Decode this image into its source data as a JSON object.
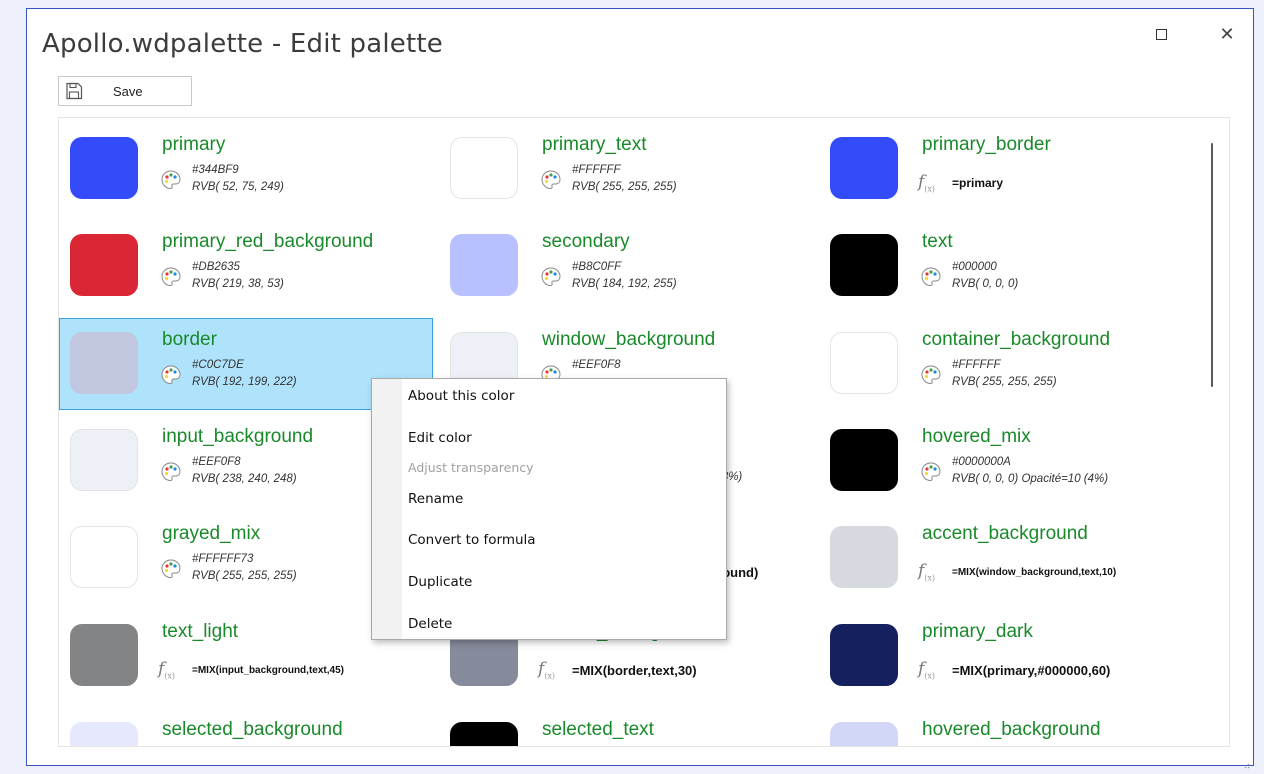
{
  "window": {
    "title": "Apollo.wdpalette - Edit palette"
  },
  "toolbar": {
    "save_label": "Save"
  },
  "items": [
    {
      "name": "primary",
      "color": "#344BF9",
      "kind": "color",
      "hex": "#344BF9",
      "rgb": "RVB( 52, 75, 249)"
    },
    {
      "name": "primary_text",
      "color": "#FFFFFF",
      "kind": "color",
      "hex": "#FFFFFF",
      "rgb": "RVB( 255, 255, 255)"
    },
    {
      "name": "primary_border",
      "color": "#344BF9",
      "kind": "formula",
      "formula": "=primary"
    },
    {
      "name": "primary_red_background",
      "color": "#DB2635",
      "kind": "color",
      "hex": "#DB2635",
      "rgb": "RVB( 219, 38, 53)"
    },
    {
      "name": "secondary",
      "color": "#B8C0FF",
      "kind": "color",
      "hex": "#B8C0FF",
      "rgb": "RVB( 184, 192, 255)"
    },
    {
      "name": "text",
      "color": "#000000",
      "kind": "color",
      "hex": "#000000",
      "rgb": "RVB( 0, 0, 0)"
    },
    {
      "name": "border",
      "color": "#C0C7DE",
      "kind": "color",
      "hex": "#C0C7DE",
      "rgb": "RVB( 192, 199, 222)"
    },
    {
      "name": "window_background",
      "color": "#EEF0F8",
      "kind": "color",
      "hex": "#EEF0F8",
      "rgb": ""
    },
    {
      "name": "container_background",
      "color": "#FFFFFF",
      "kind": "color",
      "hex": "#FFFFFF",
      "rgb": "RVB( 255, 255, 255)"
    },
    {
      "name": "input_background",
      "color": "#EEF0F8",
      "kind": "color",
      "hex": "#EEF0F8",
      "rgb": "RVB( 238, 240, 248)"
    },
    {
      "name": "",
      "color": "#FFFFFF",
      "kind": "color",
      "hex": "",
      "rgb": "20 (8%)"
    },
    {
      "name": "hovered_mix",
      "color": "#000000",
      "kind": "color",
      "hex": "#0000000A",
      "rgb": "RVB( 0, 0, 0)  Opacité=10 (4%)"
    },
    {
      "name": "grayed_mix",
      "color": "#FFFFFF",
      "kind": "color",
      "hex": "#FFFFFF73",
      "rgb": "RVB( 255, 255, 255)"
    },
    {
      "name": "",
      "color": "#FFFFFF",
      "kind": "formula",
      "formula": "kground)"
    },
    {
      "name": "accent_background",
      "color": "#D6D9DF",
      "kind": "formula",
      "formula": "=MIX(window_background,text,10)"
    },
    {
      "name": "text_light",
      "color": "#838486",
      "kind": "formula",
      "formula": "=MIX(input_background,text,45)"
    },
    {
      "name": "border_strong",
      "color": "#868B9B",
      "kind": "formula",
      "formula": "=MIX(border,text,30)"
    },
    {
      "name": "primary_dark",
      "color": "#15205F",
      "kind": "formula",
      "formula": "=MIX(primary,#000000,60)"
    },
    {
      "name": "selected_background",
      "color": "#E6E9FE",
      "kind": "color"
    },
    {
      "name": "selected_text",
      "color": "#000000",
      "kind": "color"
    },
    {
      "name": "hovered_background",
      "color": "#D2D6F7",
      "kind": "color"
    }
  ],
  "context_menu": {
    "items": [
      {
        "label": "About this color",
        "enabled": true
      },
      {
        "label": "Edit color",
        "enabled": true
      },
      {
        "label": "Adjust transparency",
        "enabled": false
      },
      {
        "label": "Rename",
        "enabled": true
      },
      {
        "label": "Convert to formula",
        "enabled": true
      },
      {
        "label": "Duplicate",
        "enabled": true
      },
      {
        "label": "Delete",
        "enabled": true
      }
    ]
  },
  "icons": {
    "save": "floppy-disk-icon",
    "maximize": "maximize-icon",
    "close": "close-icon",
    "palette": "palette-icon",
    "formula": "formula-fx-icon"
  }
}
